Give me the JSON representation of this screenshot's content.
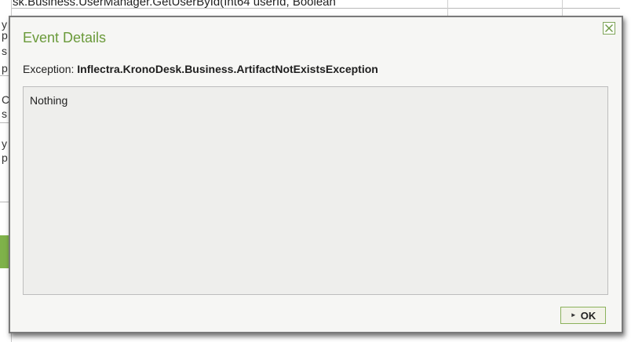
{
  "background": {
    "top_text": "sk.Business.UserManager.GetUserById(Int64 userId, Boolean",
    "left_fragments": [
      "y",
      "p",
      "s",
      "p",
      "C",
      "s",
      "y",
      "p"
    ]
  },
  "dialog": {
    "title": "Event Details",
    "exception_label": "Exception:",
    "exception_value": "Inflectra.KronoDesk.Business.ArtifactNotExistsException",
    "details_text": "Nothing",
    "ok_label": "OK",
    "icons": {
      "close": "close-icon",
      "ok_arrow": "play-arrow-icon"
    }
  },
  "colors": {
    "accent_green": "#6a9a3a",
    "button_border": "#8bb25b",
    "dialog_bg": "#f6f6f4"
  }
}
